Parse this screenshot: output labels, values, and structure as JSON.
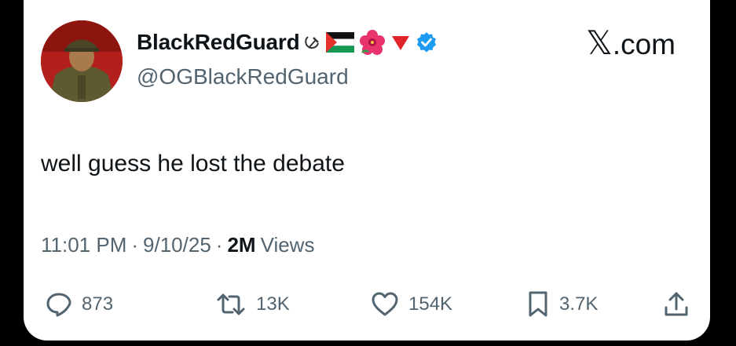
{
  "author": {
    "display_name": "BlackRedGuard",
    "handle": "@OGBlackRedGuard",
    "badges": [
      "hammer-sickle-icon",
      "palestine-flag-icon",
      "hibiscus-icon",
      "red-triangle-icon",
      "verified-badge-icon"
    ],
    "verified_color": "#1d9bf0"
  },
  "brand": {
    "label": ".com",
    "mark": "𝕏"
  },
  "tweet": {
    "text": "well guess he lost the debate"
  },
  "meta": {
    "time": "11:01 PM",
    "sep1": "·",
    "date": "9/10/25",
    "sep2": "·",
    "views_count": "2M",
    "views_label": "Views"
  },
  "actions": {
    "replies": "873",
    "reposts": "13K",
    "likes": "154K",
    "bookmarks": "3.7K"
  },
  "colors": {
    "text": "#0f1419",
    "secondary": "#536471",
    "background": "#ffffff",
    "frame": "#000000"
  }
}
